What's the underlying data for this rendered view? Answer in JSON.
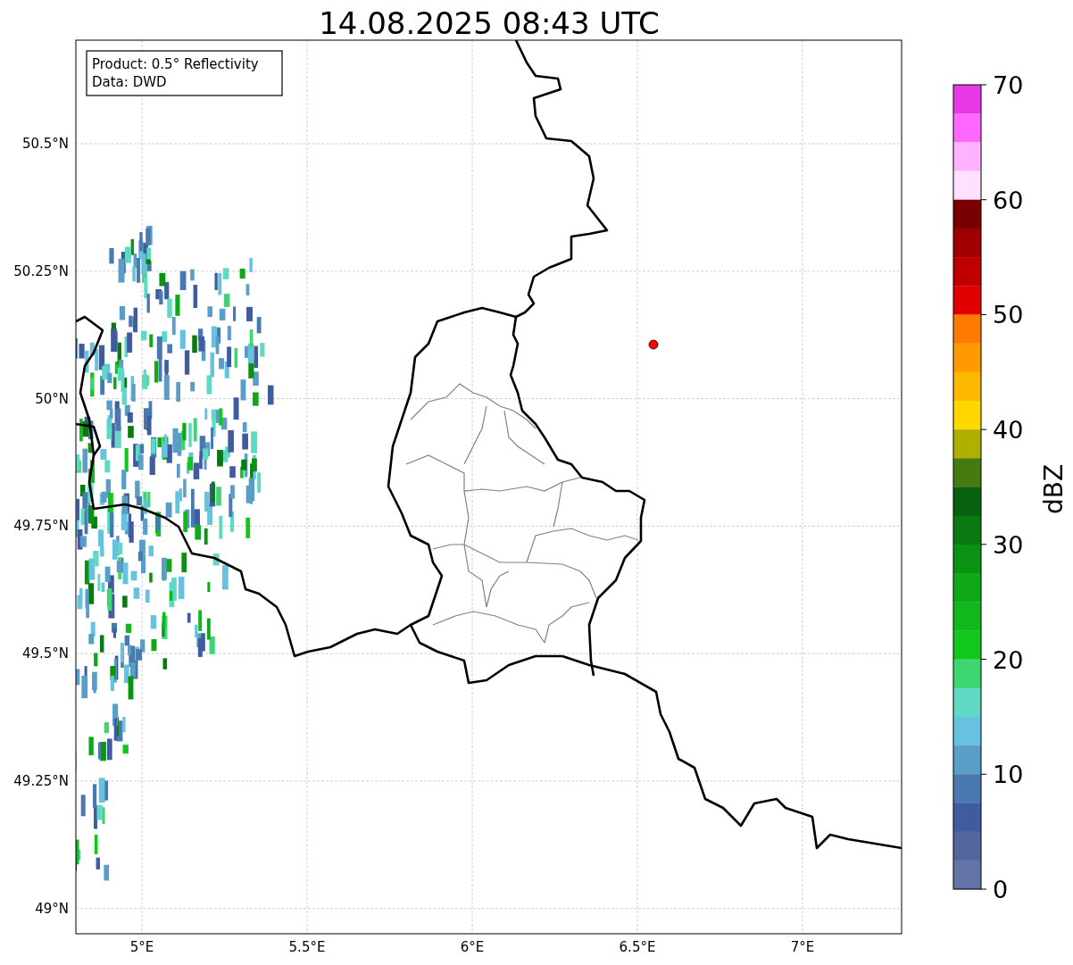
{
  "title": "14.08.2025 08:43 UTC",
  "info_box": {
    "lines": [
      "Product: 0.5° Reflectivity",
      "Data: DWD"
    ]
  },
  "map": {
    "yticks": [
      "50.5°N",
      "50.25°N",
      "50°N",
      "49.75°N",
      "49.5°N",
      "49.25°N",
      "49°N"
    ],
    "xticks": [
      "5°E",
      "5.5°E",
      "6°E",
      "6.5°E",
      "7°E"
    ]
  },
  "colorbar": {
    "label": "dBZ",
    "ticks": [
      "70",
      "60",
      "50",
      "40",
      "30",
      "20",
      "10",
      "0"
    ],
    "bands": [
      {
        "color": "#e838e8"
      },
      {
        "color": "#ff68ff"
      },
      {
        "color": "#ffb2ff"
      },
      {
        "color": "#ffe0ff"
      },
      {
        "color": "#780000"
      },
      {
        "color": "#a00000"
      },
      {
        "color": "#c00000"
      },
      {
        "color": "#e00000"
      },
      {
        "color": "#ff7a00"
      },
      {
        "color": "#ff9a00"
      },
      {
        "color": "#ffb800"
      },
      {
        "color": "#ffd800"
      },
      {
        "color": "#b0b000"
      },
      {
        "color": "#477a0f"
      },
      {
        "color": "#06600e"
      },
      {
        "color": "#097a10"
      },
      {
        "color": "#0b9213"
      },
      {
        "color": "#0fa817"
      },
      {
        "color": "#10b81c"
      },
      {
        "color": "#10c81c"
      },
      {
        "color": "#3ed670"
      },
      {
        "color": "#5fd8c4"
      },
      {
        "color": "#66c2de"
      },
      {
        "color": "#5a9ec8"
      },
      {
        "color": "#4a79b0"
      },
      {
        "color": "#405c9e"
      },
      {
        "color": "#52679e"
      },
      {
        "color": "#6374a6"
      }
    ]
  }
}
